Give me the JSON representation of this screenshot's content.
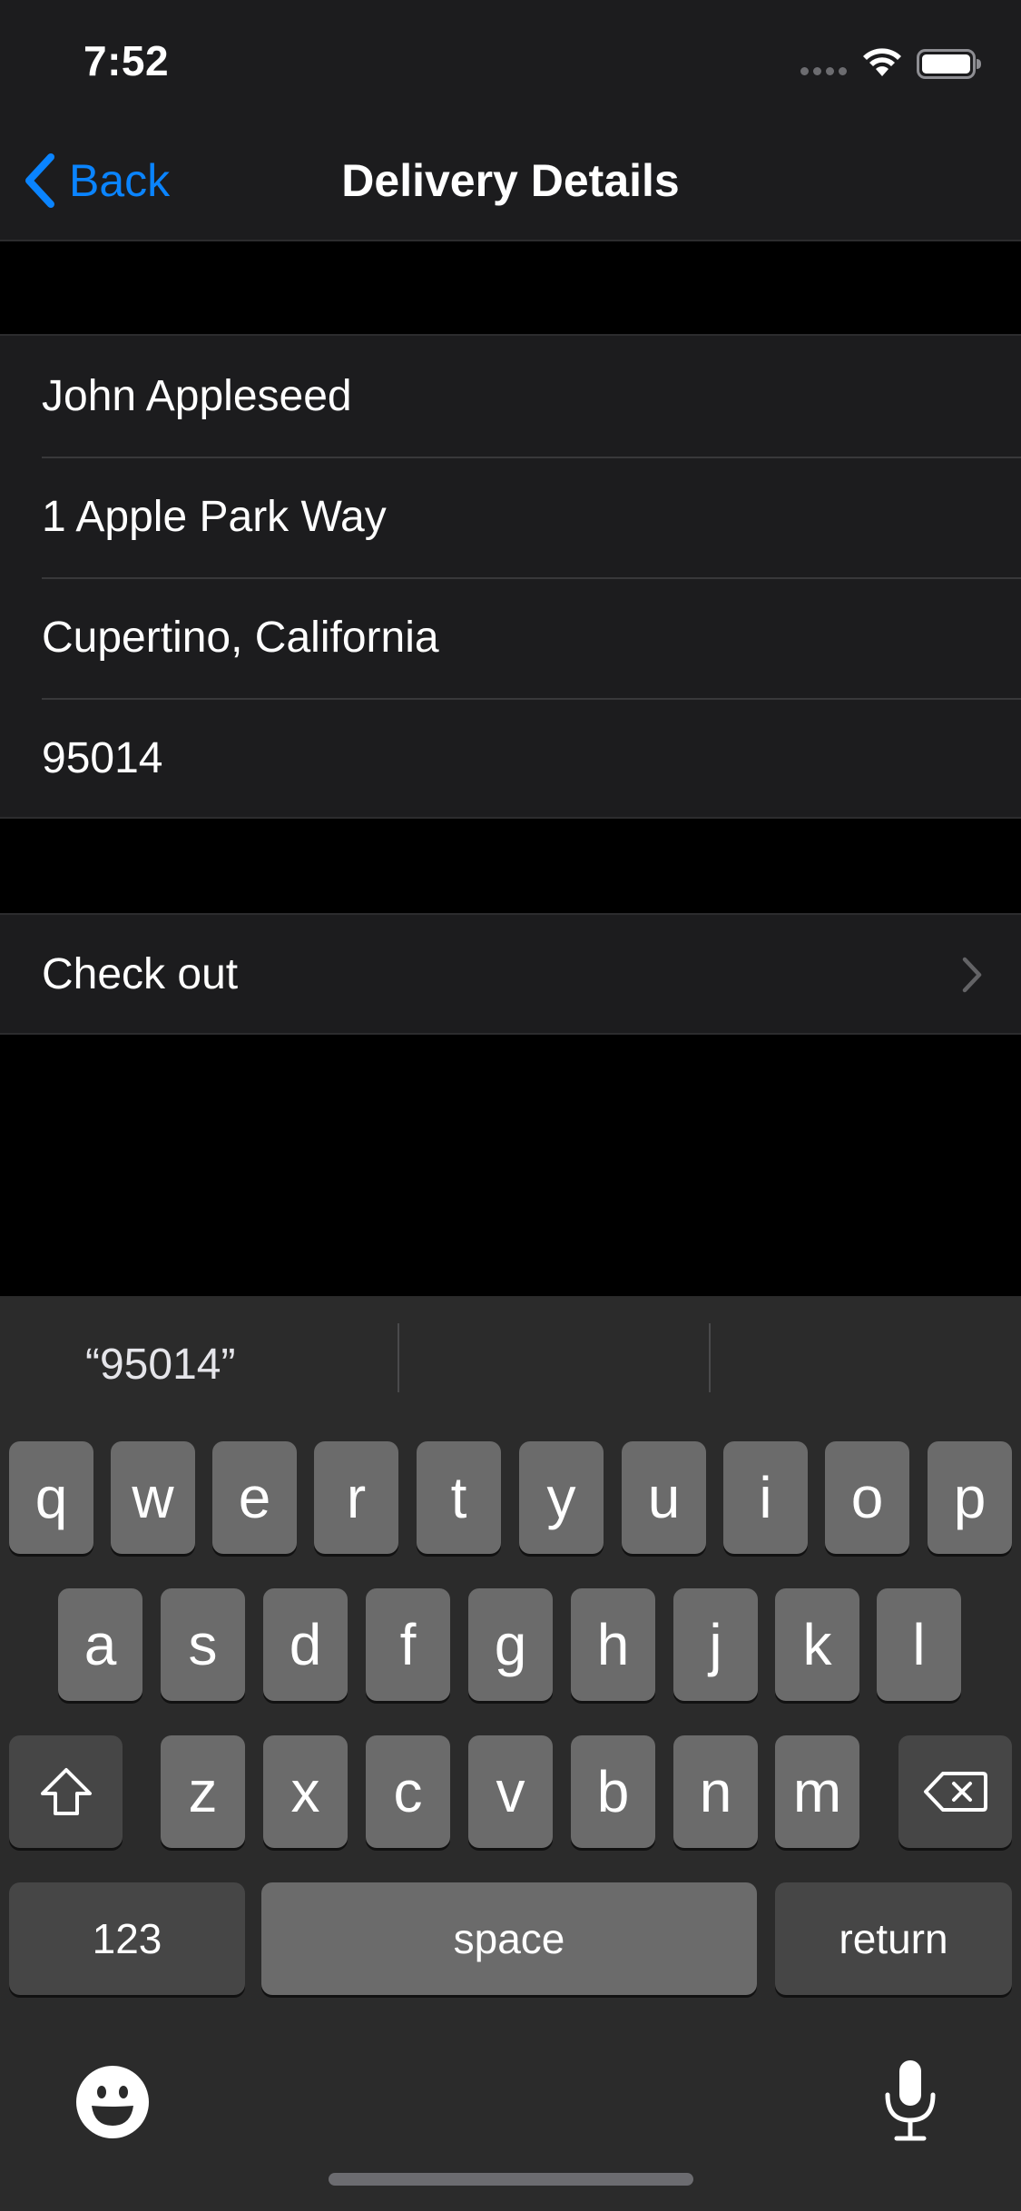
{
  "status_bar": {
    "time": "7:52"
  },
  "nav": {
    "back_label": "Back",
    "title": "Delivery Details"
  },
  "address_fields": [
    {
      "value": "John Appleseed"
    },
    {
      "value": "1 Apple Park Way"
    },
    {
      "value": "Cupertino, California"
    },
    {
      "value": "95014"
    }
  ],
  "checkout": {
    "label": "Check out"
  },
  "keyboard": {
    "predictions": [
      "“95014”",
      "",
      ""
    ],
    "row1": [
      "q",
      "w",
      "e",
      "r",
      "t",
      "y",
      "u",
      "i",
      "o",
      "p"
    ],
    "row2": [
      "a",
      "s",
      "d",
      "f",
      "g",
      "h",
      "j",
      "k",
      "l"
    ],
    "row3": [
      "z",
      "x",
      "c",
      "v",
      "b",
      "n",
      "m"
    ],
    "numbers_label": "123",
    "space_label": "space",
    "return_label": "return"
  },
  "colors": {
    "accent": "#0a84ff",
    "background": "#000000",
    "cell": "#1c1c1e",
    "key": "#6b6b6b",
    "key_dark": "#464646"
  },
  "icons": [
    "back-chevron-icon",
    "wifi-icon",
    "battery-icon",
    "chevron-right-icon",
    "shift-icon",
    "delete-icon",
    "emoji-icon",
    "microphone-icon"
  ]
}
